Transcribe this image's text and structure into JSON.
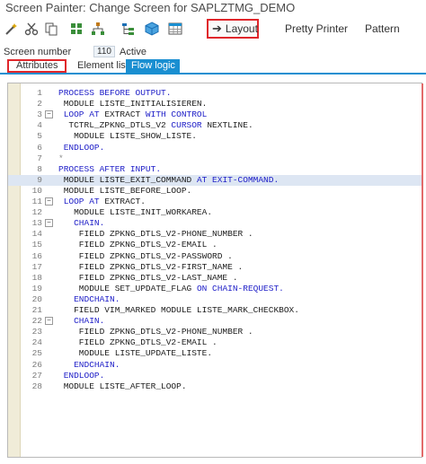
{
  "window": {
    "title": "Screen Painter: Change Screen for SAPLZTMG_DEMO"
  },
  "toolbar": {
    "icons": [
      "magic-wand-icon",
      "scissors-icon",
      "copy-icon",
      "grid-icon",
      "tree-icon",
      "tree-struct-icon",
      "cube-icon",
      "table-icon"
    ],
    "layout_label": "Layout",
    "pretty_printer_label": "Pretty Printer",
    "pattern_label": "Pattern"
  },
  "screen": {
    "number_label": "Screen number",
    "number_value": "110",
    "status": "Active"
  },
  "tabs": {
    "attributes": "Attributes",
    "element_list": "Element list",
    "flow_logic": "Flow logic"
  },
  "editor": {
    "lines": [
      {
        "n": "1",
        "fold": "",
        "segs": [
          [
            "kw",
            "PROCESS BEFORE OUTPUT."
          ]
        ]
      },
      {
        "n": "2",
        "fold": "",
        "segs": [
          [
            "t",
            " MODULE LISTE_INITIALISIEREN."
          ]
        ]
      },
      {
        "n": "3",
        "fold": "−",
        "segs": [
          [
            "kw",
            " LOOP AT "
          ],
          [
            "t",
            "EXTRACT "
          ],
          [
            "kw",
            "WITH CONTROL"
          ]
        ]
      },
      {
        "n": "4",
        "fold": "",
        "segs": [
          [
            "t",
            "  TCTRL_ZPKNG_DTLS_V2 "
          ],
          [
            "kw",
            "CURSOR "
          ],
          [
            "t",
            "NEXTLINE."
          ]
        ]
      },
      {
        "n": "5",
        "fold": "",
        "segs": [
          [
            "t",
            "   MODULE LISTE_SHOW_LISTE."
          ]
        ]
      },
      {
        "n": "6",
        "fold": "",
        "segs": [
          [
            "kw",
            " ENDLOOP."
          ]
        ]
      },
      {
        "n": "7",
        "fold": "",
        "segs": [
          [
            "cm",
            "*"
          ]
        ]
      },
      {
        "n": "8",
        "fold": "",
        "segs": [
          [
            "kw",
            "PROCESS AFTER INPUT."
          ]
        ]
      },
      {
        "n": "9",
        "fold": "",
        "hl": true,
        "segs": [
          [
            "t",
            " MODULE LISTE_EXIT_COMMAND "
          ],
          [
            "kw",
            "AT EXIT-COMMAND."
          ]
        ]
      },
      {
        "n": "10",
        "fold": "",
        "segs": [
          [
            "t",
            " MODULE LISTE_BEFORE_LOOP."
          ]
        ]
      },
      {
        "n": "11",
        "fold": "−",
        "segs": [
          [
            "kw",
            " LOOP AT "
          ],
          [
            "t",
            "EXTRACT."
          ]
        ]
      },
      {
        "n": "12",
        "fold": "",
        "segs": [
          [
            "t",
            "   MODULE LISTE_INIT_WORKAREA."
          ]
        ]
      },
      {
        "n": "13",
        "fold": "−",
        "segs": [
          [
            "kw",
            "   CHAIN."
          ]
        ]
      },
      {
        "n": "14",
        "fold": "",
        "segs": [
          [
            "t",
            "    FIELD ZPKNG_DTLS_V2-PHONE_NUMBER ."
          ]
        ]
      },
      {
        "n": "15",
        "fold": "",
        "segs": [
          [
            "t",
            "    FIELD ZPKNG_DTLS_V2-EMAIL ."
          ]
        ]
      },
      {
        "n": "16",
        "fold": "",
        "segs": [
          [
            "t",
            "    FIELD ZPKNG_DTLS_V2-PASSWORD ."
          ]
        ]
      },
      {
        "n": "17",
        "fold": "",
        "segs": [
          [
            "t",
            "    FIELD ZPKNG_DTLS_V2-FIRST_NAME ."
          ]
        ]
      },
      {
        "n": "18",
        "fold": "",
        "segs": [
          [
            "t",
            "    FIELD ZPKNG_DTLS_V2-LAST_NAME ."
          ]
        ]
      },
      {
        "n": "19",
        "fold": "",
        "segs": [
          [
            "t",
            "    MODULE SET_UPDATE_FLAG "
          ],
          [
            "kw",
            "ON CHAIN-REQUEST."
          ]
        ]
      },
      {
        "n": "20",
        "fold": "",
        "segs": [
          [
            "kw",
            "   ENDCHAIN."
          ]
        ]
      },
      {
        "n": "21",
        "fold": "",
        "segs": [
          [
            "t",
            "   FIELD VIM_MARKED MODULE LISTE_MARK_CHECKBOX."
          ]
        ]
      },
      {
        "n": "22",
        "fold": "−",
        "segs": [
          [
            "kw",
            "   CHAIN."
          ]
        ]
      },
      {
        "n": "23",
        "fold": "",
        "segs": [
          [
            "t",
            "    FIELD ZPKNG_DTLS_V2-PHONE_NUMBER ."
          ]
        ]
      },
      {
        "n": "24",
        "fold": "",
        "segs": [
          [
            "t",
            "    FIELD ZPKNG_DTLS_V2-EMAIL ."
          ]
        ]
      },
      {
        "n": "25",
        "fold": "",
        "segs": [
          [
            "t",
            "    MODULE LISTE_UPDATE_LISTE."
          ]
        ]
      },
      {
        "n": "26",
        "fold": "",
        "segs": [
          [
            "kw",
            "   ENDCHAIN."
          ]
        ]
      },
      {
        "n": "27",
        "fold": "",
        "segs": [
          [
            "kw",
            " ENDLOOP."
          ]
        ]
      },
      {
        "n": "28",
        "fold": "",
        "segs": [
          [
            "t",
            " MODULE LISTE_AFTER_LOOP."
          ]
        ]
      }
    ]
  },
  "colors": {
    "keyword": "#2020c8",
    "tab_active": "#1a8fd1",
    "highlight_box": "#e0262b",
    "gutter": "#f0ecd8",
    "line_highlight": "#dde6f3"
  }
}
